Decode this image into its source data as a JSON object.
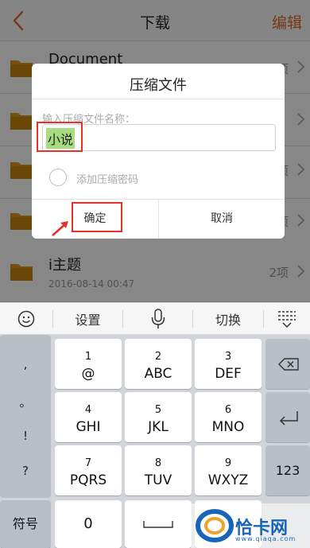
{
  "header": {
    "title": "下载",
    "edit_label": "编辑"
  },
  "list": [
    {
      "name": "Document",
      "date": "",
      "count": "2项"
    },
    {
      "name": "",
      "date": "",
      "count": ""
    },
    {
      "name": "",
      "date": "",
      "count": ""
    },
    {
      "name": "",
      "date": "",
      "count": ""
    },
    {
      "name": "i主题",
      "date": "2016-08-14 00:47",
      "count": "2项"
    }
  ],
  "row_counts_partial": [
    "项",
    "项",
    "项"
  ],
  "dialog": {
    "title": "压缩文件",
    "hint": "输入压缩文件名称：",
    "input_value": "小说",
    "password_label": "添加压缩密码",
    "confirm_label": "确定",
    "cancel_label": "取消"
  },
  "keyboard": {
    "toolbar": {
      "emoji_icon": "emoji-icon",
      "settings_label": "设置",
      "mic_icon": "mic-icon",
      "switch_label": "切换",
      "collapse_icon": "keyboard-collapse-icon"
    },
    "punctuation": [
      ",",
      "。",
      "!",
      "?"
    ],
    "keys": [
      {
        "num": "1",
        "letters": "@"
      },
      {
        "num": "2",
        "letters": "ABC"
      },
      {
        "num": "3",
        "letters": "DEF"
      },
      {
        "num": "4",
        "letters": "GHI"
      },
      {
        "num": "5",
        "letters": "JKL"
      },
      {
        "num": "6",
        "letters": "MNO"
      },
      {
        "num": "7",
        "letters": "PQRS"
      },
      {
        "num": "8",
        "letters": "TUV"
      },
      {
        "num": "9",
        "letters": "WXYZ"
      }
    ],
    "symbol_label": "符号",
    "zero_label": "0",
    "num_switch_label": "123",
    "backspace_icon": "backspace-icon",
    "enter_icon": "enter-icon",
    "space_icon": "space-icon"
  },
  "watermark": {
    "text": "恰卡网",
    "sub": "www.qiaqa.com"
  },
  "colors": {
    "accent": "#e0682c",
    "folder": "#d79a1e",
    "highlight": "#a7dc7f",
    "annotation": "#e2322b"
  }
}
